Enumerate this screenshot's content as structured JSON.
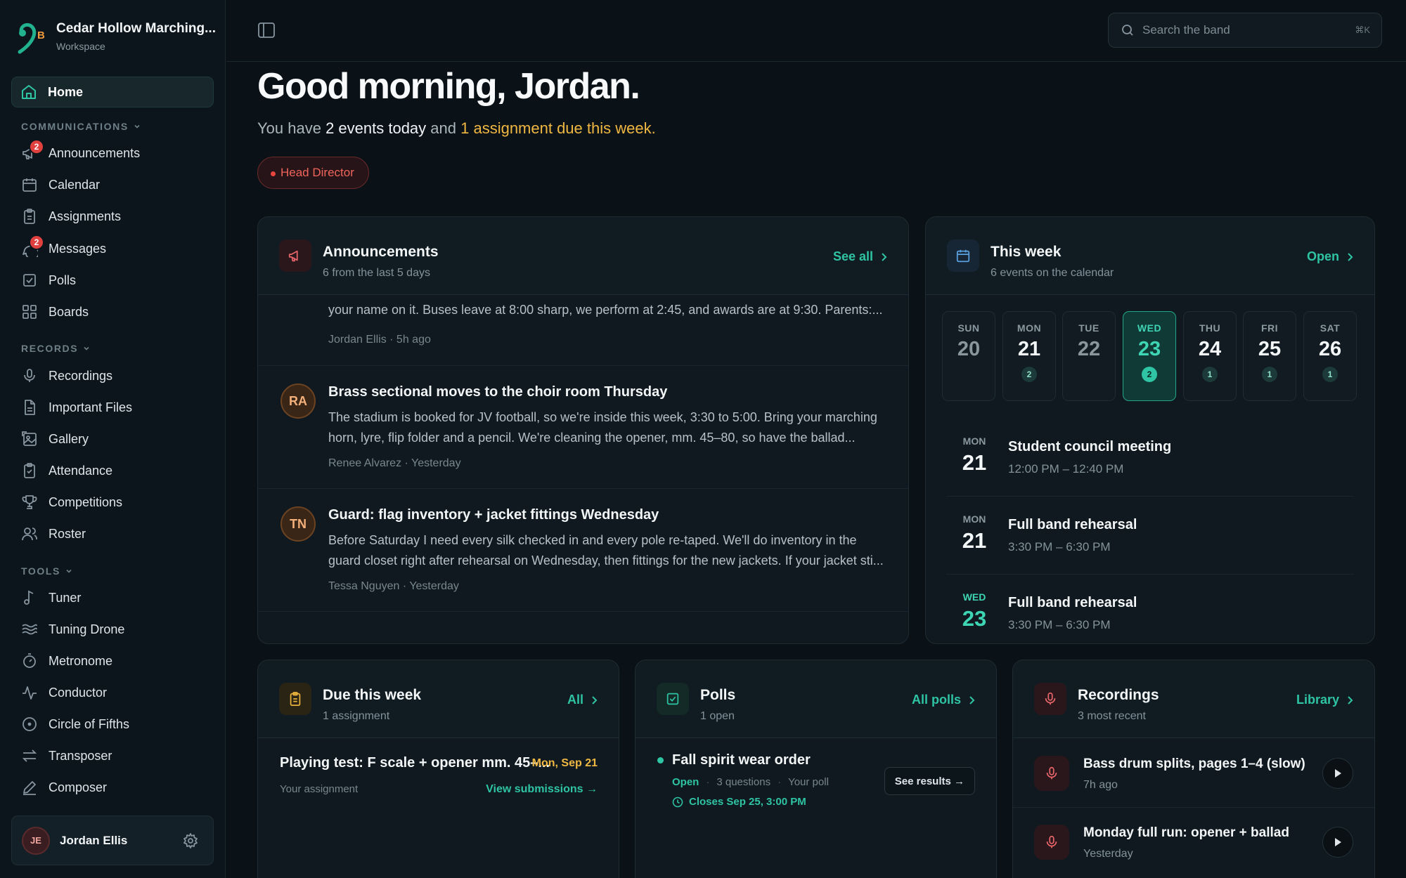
{
  "brand": {
    "name": "Cedar Hollow Marching...",
    "sub": "Workspace",
    "logo_text": "B"
  },
  "nav": {
    "home": "Home",
    "sections": [
      {
        "title": "COMMUNICATIONS",
        "items": [
          {
            "label": "Announcements",
            "icon": "megaphone-icon",
            "badge": "2"
          },
          {
            "label": "Calendar",
            "icon": "calendar-icon"
          },
          {
            "label": "Assignments",
            "icon": "clipboard-icon"
          },
          {
            "label": "Messages",
            "icon": "chat-icon",
            "badge": "2"
          },
          {
            "label": "Polls",
            "icon": "poll-icon"
          },
          {
            "label": "Boards",
            "icon": "grid-icon"
          }
        ]
      },
      {
        "title": "RECORDS",
        "items": [
          {
            "label": "Recordings",
            "icon": "mic-icon"
          },
          {
            "label": "Important Files",
            "icon": "file-icon"
          },
          {
            "label": "Gallery",
            "icon": "image-icon"
          },
          {
            "label": "Attendance",
            "icon": "clipboard-check-icon"
          },
          {
            "label": "Competitions",
            "icon": "trophy-icon"
          },
          {
            "label": "Roster",
            "icon": "users-icon"
          }
        ]
      },
      {
        "title": "TOOLS",
        "items": [
          {
            "label": "Tuner",
            "icon": "music-note-icon"
          },
          {
            "label": "Tuning Drone",
            "icon": "waves-icon"
          },
          {
            "label": "Metronome",
            "icon": "timer-icon"
          },
          {
            "label": "Conductor",
            "icon": "pulse-icon"
          },
          {
            "label": "Circle of Fifths",
            "icon": "circle-icon"
          },
          {
            "label": "Transposer",
            "icon": "arrows-icon"
          },
          {
            "label": "Composer",
            "icon": "pen-icon"
          }
        ]
      }
    ]
  },
  "user": {
    "name": "Jordan Ellis",
    "initials": "JE"
  },
  "search": {
    "placeholder": "Search the band",
    "shortcut": "⌘K"
  },
  "greeting": {
    "title": "Good morning, Jordan.",
    "pre": "You have ",
    "events": "2 events today",
    "mid": " and ",
    "assign": "1 assignment due this week.",
    "role": "Head Director"
  },
  "announcements": {
    "title": "Announcements",
    "sub": "6 from the last 5 days",
    "link": "See all",
    "items": [
      {
        "initials": "",
        "title": "",
        "body": "your name on it. Buses leave at 8:00 sharp, we perform at 2:45, and awards are at 9:30. Parents:...",
        "meta": "Jordan Ellis · 5h ago"
      },
      {
        "initials": "RA",
        "title": "Brass sectional moves to the choir room Thursday",
        "body": "The stadium is booked for JV football, so we're inside this week, 3:30 to 5:00. Bring your marching horn, lyre, flip folder and a pencil. We're cleaning the opener, mm. 45–80, so have the ballad...",
        "meta": "Renee Alvarez · Yesterday"
      },
      {
        "initials": "TN",
        "title": "Guard: flag inventory + jacket fittings Wednesday",
        "body": "Before Saturday I need every silk checked in and every pole re-taped. We'll do inventory in the guard closet right after rehearsal on Wednesday, then fittings for the new jackets. If your jacket sti...",
        "meta": "Tessa Nguyen · Yesterday"
      }
    ]
  },
  "week": {
    "title": "This week",
    "sub": "6 events on the calendar",
    "link": "Open",
    "days": [
      {
        "dow": "SUN",
        "num": "20",
        "count": ""
      },
      {
        "dow": "MON",
        "num": "21",
        "count": "2"
      },
      {
        "dow": "TUE",
        "num": "22",
        "count": ""
      },
      {
        "dow": "WED",
        "num": "23",
        "count": "2"
      },
      {
        "dow": "THU",
        "num": "24",
        "count": "1"
      },
      {
        "dow": "FRI",
        "num": "25",
        "count": "1"
      },
      {
        "dow": "SAT",
        "num": "26",
        "count": "1"
      }
    ],
    "events": [
      {
        "dow": "MON",
        "day": "21",
        "title": "Student council meeting",
        "time": "12:00 PM – 12:40 PM"
      },
      {
        "dow": "MON",
        "day": "21",
        "title": "Full band rehearsal",
        "time": "3:30 PM – 6:30 PM"
      },
      {
        "dow": "WED",
        "day": "23",
        "title": "Full band rehearsal",
        "time": "3:30 PM – 6:30 PM"
      }
    ]
  },
  "due": {
    "title": "Due this week",
    "sub": "1 assignment",
    "link": "All",
    "item": {
      "title": "Playing test: F scale + opener mm. 45–...",
      "date": "Mon, Sep 21",
      "meta": "Your assignment",
      "action": "View submissions →"
    }
  },
  "polls": {
    "title": "Polls",
    "sub": "1 open",
    "link": "All polls",
    "item": {
      "title": "Fall spirit wear order",
      "status": "Open",
      "questions": "3 questions",
      "owner": "Your poll",
      "closes": "Closes Sep 25, 3:00 PM",
      "action": "See results →"
    }
  },
  "recordings": {
    "title": "Recordings",
    "sub": "3 most recent",
    "link": "Library",
    "items": [
      {
        "title": "Bass drum splits, pages 1–4 (slow)",
        "time": "7h ago"
      },
      {
        "title": "Monday full run: opener + ballad",
        "time": "Yesterday"
      }
    ]
  },
  "colors": {
    "accent": "#2ec4a4",
    "amber": "#f0b842",
    "danger": "#e8453f",
    "bg": "#0b1217"
  }
}
